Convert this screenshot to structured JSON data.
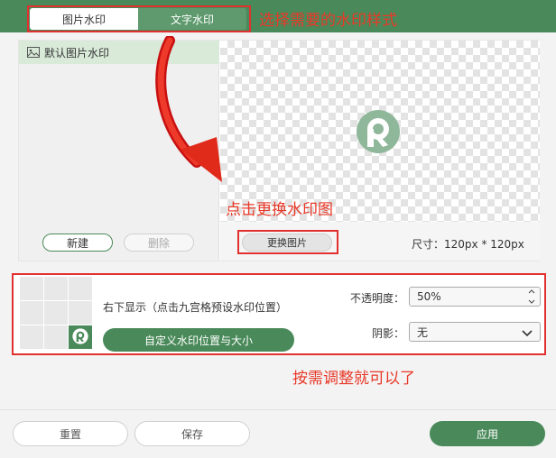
{
  "tabs": [
    {
      "label": "图片水印",
      "active": true
    },
    {
      "label": "文字水印",
      "active": false
    }
  ],
  "annotations": {
    "select_style": "选择需要的水印样式",
    "click_change": "点击更换水印图",
    "adjust": "按需调整就可以了"
  },
  "watermark_list": {
    "items": [
      "默认图片水印"
    ],
    "new_label": "新建",
    "delete_label": "删除"
  },
  "preview": {
    "change_label": "更换图片",
    "size_label": "尺寸：120px * 120px"
  },
  "position": {
    "text": "右下显示（点击九宫格预设水印位置）",
    "custom_label": "自定义水印位置与大小",
    "selected_cell": 9
  },
  "opacity": {
    "label": "不透明度：",
    "value": "50%"
  },
  "shadow": {
    "label": "阴影：",
    "value": "无"
  },
  "footer": {
    "reset_label": "重置",
    "save_label": "保存",
    "apply_label": "应用"
  },
  "colors": {
    "accent": "#4a8a5a",
    "annotation": "#e83828"
  }
}
